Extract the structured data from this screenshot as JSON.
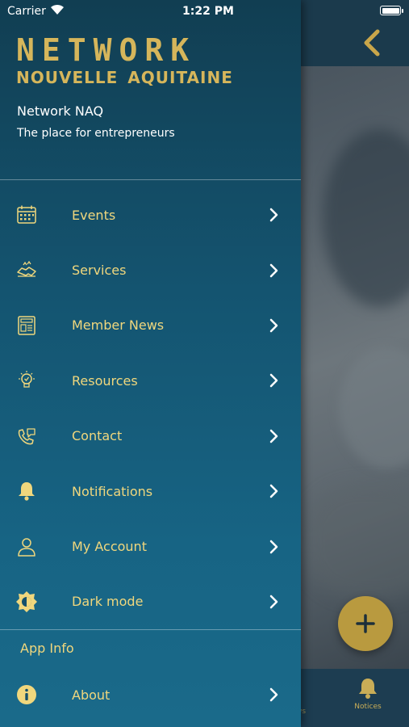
{
  "status_bar": {
    "carrier": "Carrier",
    "time": "1:22 PM"
  },
  "background": {
    "tab_notices_label": "Notices",
    "tab_partial_label": "ws"
  },
  "drawer": {
    "logo": {
      "line1": "NETWORK",
      "line2_left": "NOUVELLE",
      "line2_right": "AQUITAINE"
    },
    "org_name": "Network NAQ",
    "tagline": "The place for entrepreneurs",
    "menu": [
      {
        "label": "Events",
        "icon": "calendar-icon"
      },
      {
        "label": "Services",
        "icon": "handshake-icon"
      },
      {
        "label": "Member News",
        "icon": "newspaper-icon"
      },
      {
        "label": "Resources",
        "icon": "lightbulb-icon"
      },
      {
        "label": "Contact",
        "icon": "phone-chat-icon"
      },
      {
        "label": "Notifications",
        "icon": "bell-icon"
      },
      {
        "label": "My Account",
        "icon": "user-icon"
      },
      {
        "label": "Dark mode",
        "icon": "brightness-icon"
      }
    ],
    "section_title": "App Info",
    "about": {
      "label": "About",
      "icon": "info-icon"
    }
  },
  "colors": {
    "accent": "#f0d77d",
    "logo_gold": "#d6b65b",
    "fab": "#b99a3f",
    "drawer_top": "#113e52",
    "drawer_bottom": "#1a6a8a"
  }
}
